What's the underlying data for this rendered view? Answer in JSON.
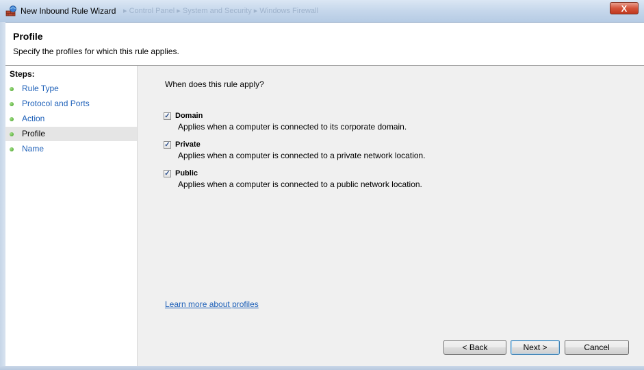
{
  "window": {
    "title": "New Inbound Rule Wizard",
    "background_path": "▸ Control Panel ▸ System and Security ▸ Windows Firewall",
    "close_label": "X"
  },
  "header": {
    "title": "Profile",
    "subtitle": "Specify the profiles for which this rule applies."
  },
  "steps": {
    "title": "Steps:",
    "items": [
      {
        "label": "Rule Type"
      },
      {
        "label": "Protocol and Ports"
      },
      {
        "label": "Action"
      },
      {
        "label": "Profile"
      },
      {
        "label": "Name"
      }
    ],
    "current_index": 3
  },
  "main": {
    "question": "When does this rule apply?",
    "options": [
      {
        "label": "Domain",
        "description": "Applies when a computer is connected to its corporate domain.",
        "checked": true
      },
      {
        "label": "Private",
        "description": "Applies when a computer is connected to a private network location.",
        "checked": true
      },
      {
        "label": "Public",
        "description": "Applies when a computer is connected to a public network location.",
        "checked": true
      }
    ],
    "learn_more": "Learn more about profiles"
  },
  "buttons": {
    "back": "< Back",
    "next": "Next >",
    "cancel": "Cancel"
  },
  "colors": {
    "link": "#1c5fb8",
    "step_dot": "#3e9a1d",
    "main_bg": "#f0f0f0",
    "close_button": "#c0391f"
  },
  "icons": {
    "title_icon": "firewall-wizard-icon",
    "step_bullet": "green-dot-icon",
    "checkbox_mark": "checkmark-icon"
  }
}
